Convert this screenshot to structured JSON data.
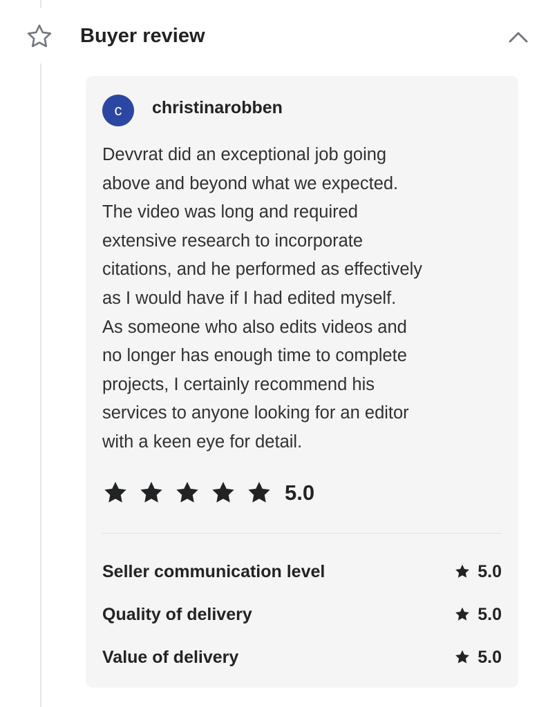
{
  "header": {
    "title": "Buyer review",
    "star_icon": "star-outline-icon",
    "collapse_icon": "chevron-up-icon"
  },
  "review": {
    "avatar_initial": "c",
    "avatar_color": "#2b47a3",
    "username": "christinarobben",
    "text_lines": [
      "Devvrat did an exceptional job going",
      "above and beyond what we expected.",
      "The video was long and required",
      "extensive research to incorporate",
      "citations, and he performed as effectively",
      "as I would have if I had edited myself.",
      "As someone who also edits videos and",
      "no longer has enough time to complete",
      "projects, I certainly recommend his",
      "services to anyone looking for an editor",
      "with a keen eye for detail."
    ],
    "overall": {
      "stars": 5,
      "score": "5.0",
      "star_icon": "star-filled-icon"
    },
    "sub_ratings": [
      {
        "label": "Seller communication level",
        "value": "5.0"
      },
      {
        "label": "Quality of delivery",
        "value": "5.0"
      },
      {
        "label": "Value of delivery",
        "value": "5.0"
      }
    ]
  },
  "colors": {
    "card_background": "#f5f5f5",
    "text": "#222325",
    "star": "#222325"
  }
}
